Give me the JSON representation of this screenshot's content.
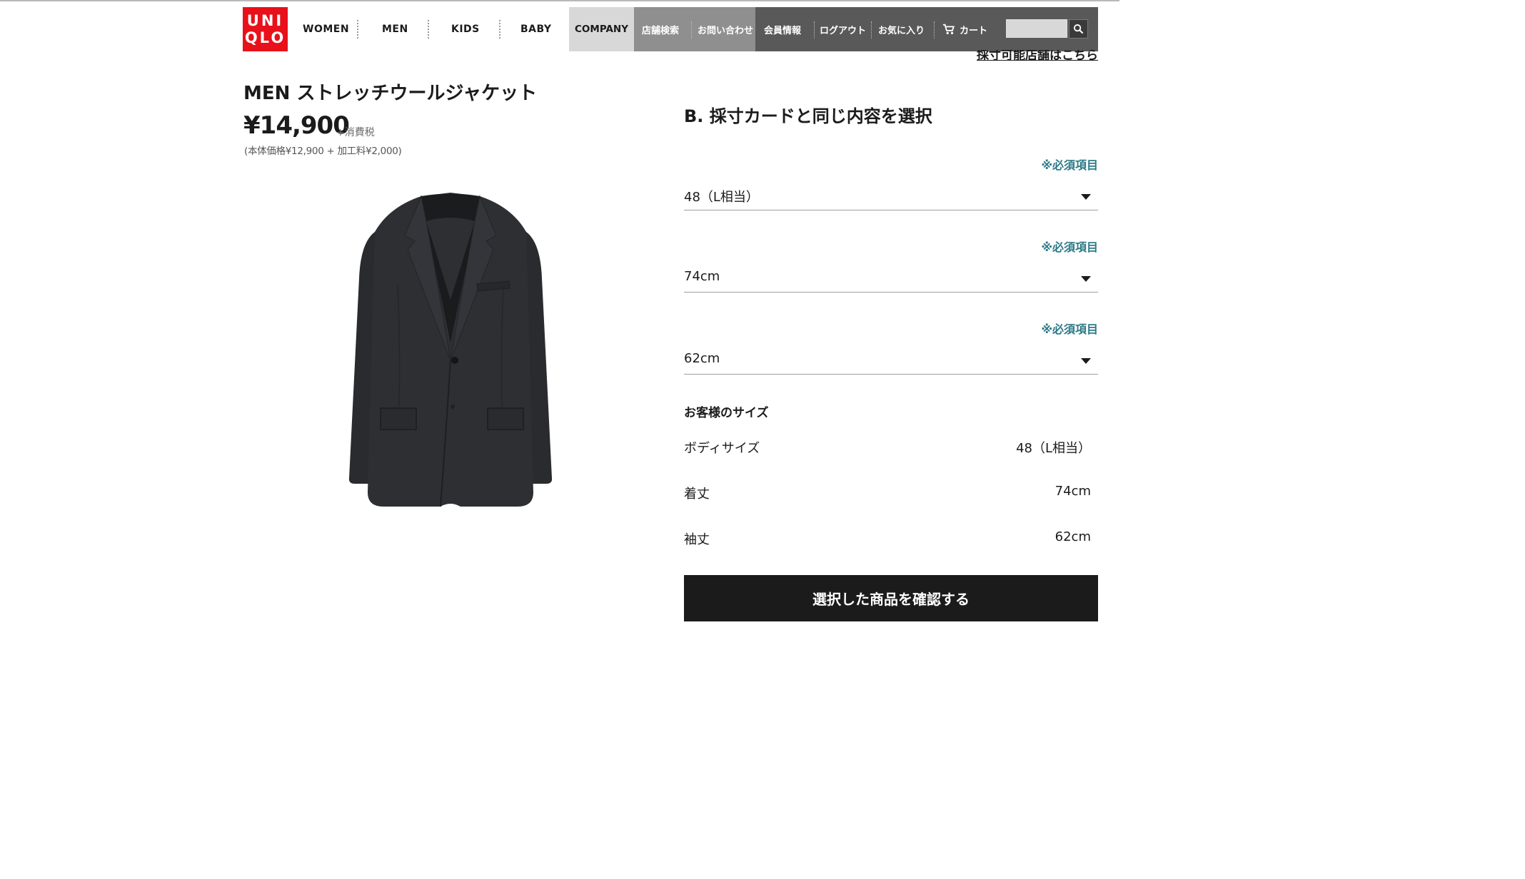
{
  "header": {
    "logo_line1": "UNI",
    "logo_line2": "QLO",
    "nav": [
      "WOMEN",
      "MEN",
      "KIDS",
      "BABY"
    ],
    "company": "COMPANY",
    "util_gray": [
      "店舗検索",
      "お問い合わせ"
    ],
    "util_dark": [
      "会員情報",
      "ログアウト",
      "お気に入り"
    ],
    "cart": "カート",
    "search_placeholder": "",
    "store_link": "採寸可能店舗はこちら"
  },
  "product": {
    "title": "MEN ストレッチウールジャケット",
    "price": "¥14,900",
    "tax_note": "+消費税",
    "breakdown": "(本体価格¥12,900 + 加工料¥2,000)",
    "image": "black-wool-jacket"
  },
  "form": {
    "heading": "B. 採寸カードと同じ内容を選択",
    "required_label": "※必須項目",
    "selects": [
      {
        "value": "48（L相当）"
      },
      {
        "value": "74cm"
      },
      {
        "value": "62cm"
      }
    ]
  },
  "summary": {
    "heading": "お客様のサイズ",
    "rows": [
      {
        "label": "ボディサイズ",
        "value": "48（L相当）"
      },
      {
        "label": "着丈",
        "value": "74cm"
      },
      {
        "label": "袖丈",
        "value": "62cm"
      }
    ]
  },
  "confirm_label": "選択した商品を確認する",
  "colors": {
    "brand_red": "#e8101a",
    "required_teal": "#2c7a87",
    "button_dark": "#1b1b1b"
  }
}
